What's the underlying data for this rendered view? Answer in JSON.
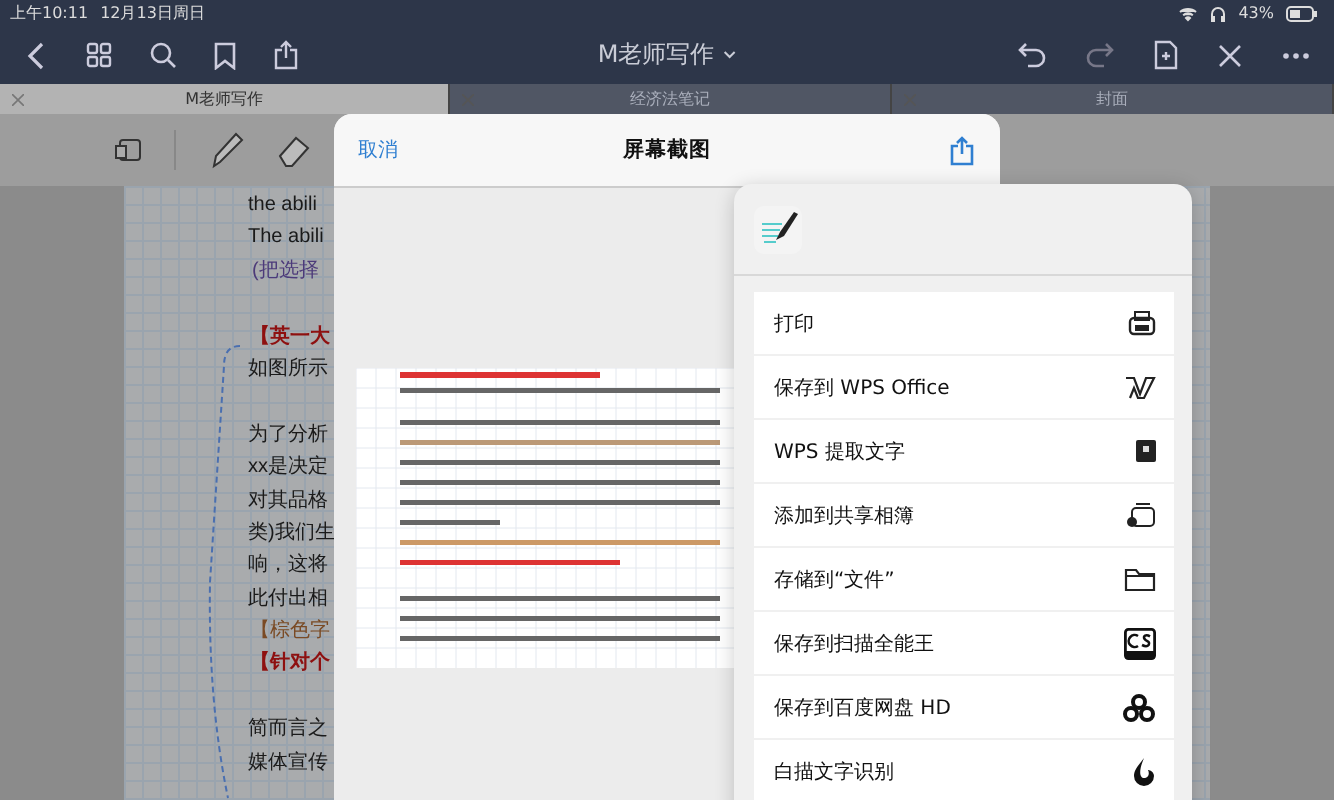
{
  "status_bar": {
    "time": "上午10:11",
    "date": "12月13日周日",
    "battery": "43%"
  },
  "nav": {
    "title": "M老师写作"
  },
  "tabs": [
    {
      "label": "M老师写作",
      "selected": true
    },
    {
      "label": "经济法笔记",
      "selected": false
    },
    {
      "label": "封面",
      "selected": false
    }
  ],
  "document_lines": [
    {
      "text": "the abili",
      "kind": "plain"
    },
    {
      "text": "The abili",
      "kind": "plain"
    },
    {
      "text": "(把选择",
      "kind": "purple"
    },
    {
      "kind": "gap"
    },
    {
      "text": "【英一大",
      "kind": "red"
    },
    {
      "text": "如图所示",
      "kind": "plain"
    },
    {
      "kind": "gap"
    },
    {
      "text": "为了分析",
      "kind": "plain"
    },
    {
      "text": "xx是决定",
      "kind": "plain"
    },
    {
      "text": "对其品格",
      "kind": "plain"
    },
    {
      "text": "类)我们生",
      "kind": "plain"
    },
    {
      "text": "响，这将",
      "kind": "plain"
    },
    {
      "text": "此付出相",
      "kind": "plain"
    },
    {
      "text": "【棕色字",
      "kind": "brown"
    },
    {
      "text": "【针对个",
      "kind": "red"
    },
    {
      "kind": "gap"
    },
    {
      "text": "简而言之",
      "kind": "plain"
    },
    {
      "text": "媒体宣传",
      "kind": "plain"
    }
  ],
  "modal": {
    "cancel": "取消",
    "title": "屏幕截图"
  },
  "share_menu": {
    "actions": [
      {
        "label": "打印"
      },
      {
        "label": "保存到 WPS Office"
      },
      {
        "label": "WPS 提取文字"
      },
      {
        "label": "添加到共享相簿"
      },
      {
        "label": "存储到“文件”"
      },
      {
        "label": "保存到扫描全能王"
      },
      {
        "label": "保存到百度网盘 HD"
      },
      {
        "label": "白描文字识别"
      }
    ]
  }
}
